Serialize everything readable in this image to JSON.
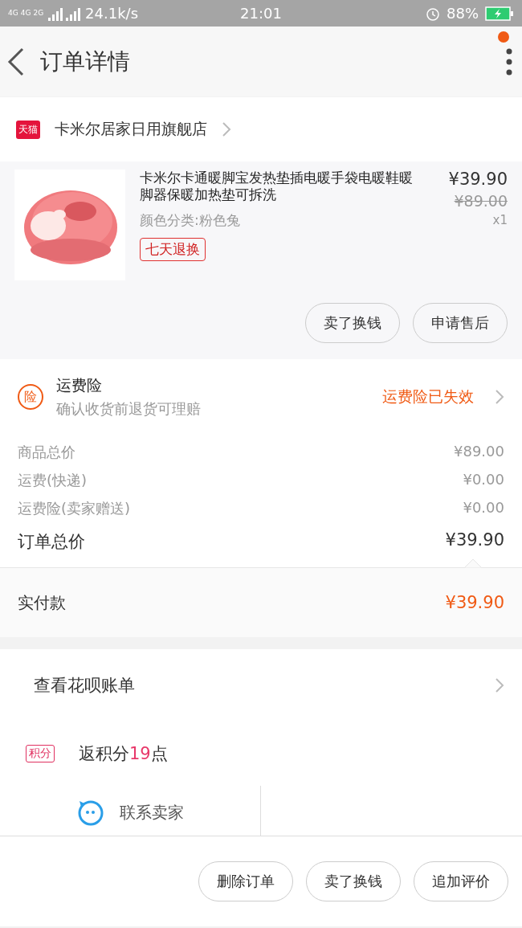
{
  "status_bar": {
    "network": [
      "4G",
      "4G",
      "2G"
    ],
    "speed": "24.1k/s",
    "time": "21:01",
    "battery": "88%"
  },
  "header": {
    "title": "订单详情",
    "notification_dot": true
  },
  "store": {
    "badge": "天猫",
    "name": "卡米尔居家日用旗舰店"
  },
  "product": {
    "kind": "picture",
    "title": "卡米尔卡通暖脚宝发热垫插电暖手袋电暖鞋暖脚器保暖加热垫可拆洗",
    "variant": "颜色分类:粉色兔",
    "tag": "七天退换",
    "price": "¥39.90",
    "original_price": "¥89.00",
    "quantity": "x1",
    "actions": [
      "卖了换钱",
      "申请售后"
    ]
  },
  "insurance": {
    "badge": "险",
    "title": "运费险",
    "subtitle": "确认收货前退货可理赔",
    "status": "运费险已失效"
  },
  "totals": [
    {
      "label": "商品总价",
      "value": "¥89.00",
      "emphasis": false
    },
    {
      "label": "运费(快递)",
      "value": "¥0.00",
      "emphasis": false
    },
    {
      "label": "运费险(卖家赠送)",
      "value": "¥0.00",
      "emphasis": false
    },
    {
      "label": "订单总价",
      "value": "¥39.90",
      "emphasis": true
    }
  ],
  "payment": {
    "label": "实付款",
    "value": "¥39.90"
  },
  "bill_link": "查看花呗账单",
  "points": {
    "badge": "积分",
    "prefix": "返积分",
    "count": "19",
    "suffix": "点"
  },
  "contact": {
    "label": "联系卖家"
  },
  "bottom_actions": [
    "删除订单",
    "卖了换钱",
    "追加评价"
  ]
}
